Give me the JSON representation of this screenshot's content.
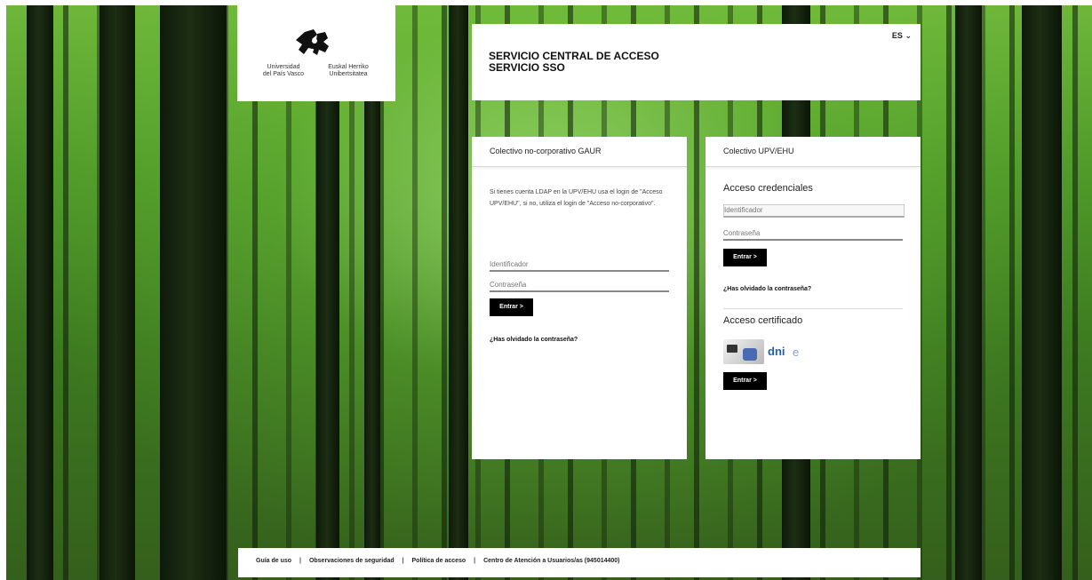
{
  "logo": {
    "left_text": "Universidad\ndel País Vasco",
    "right_text": "Euskal Herriko\nUnibertsitatea"
  },
  "header": {
    "title_line1": "SERVICIO CENTRAL DE ACCESO",
    "title_line2": "SERVICIO SSO",
    "language": "ES",
    "language_icon": "chevron-down-icon"
  },
  "card_left": {
    "heading": "Colectivo no-corporativo GAUR",
    "note": "Si tienes cuenta LDAP en la UPV/EHU usa el login de \"Acceso UPV/EHU\", si no, utiliza el login de \"Acceso no-corporativo\".",
    "username_placeholder": "Identificador",
    "password_placeholder": "Contraseña",
    "submit_label": "Entrar >",
    "forgot_label": "¿Has olvidado la contraseña?"
  },
  "card_right": {
    "heading": "Colectivo UPV/EHU",
    "credentials_title": "Acceso credenciales",
    "username_placeholder": "Identificador",
    "password_placeholder": "Contraseña",
    "submit_label": "Entrar >",
    "forgot_label": "¿Has olvidado la contraseña?",
    "certificate_title": "Acceso certificado",
    "cert_logo_text": "dni",
    "cert_logo_suffix": "e",
    "cert_submit_label": "Entrar >"
  },
  "footer": {
    "links": [
      "Guía de uso",
      "Observaciones de seguridad",
      "Política de acceso",
      "Centro de Atención a Usuarios/as (945014400)"
    ],
    "separator": "|"
  }
}
